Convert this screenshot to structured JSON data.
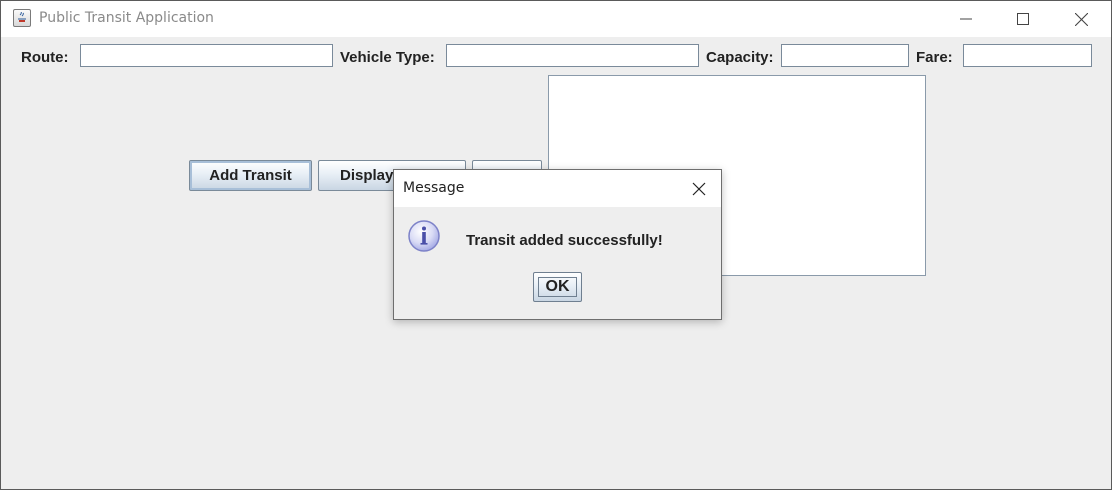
{
  "window": {
    "title": "Public Transit Application"
  },
  "form": {
    "route_label": "Route:",
    "route_value": "",
    "vehicle_type_label": "Vehicle Type:",
    "vehicle_type_value": "",
    "capacity_label": "Capacity:",
    "capacity_value": "",
    "fare_label": "Fare:",
    "fare_value": ""
  },
  "buttons": {
    "add_label": "Add Transit",
    "display_label": "Display",
    "third_label": ""
  },
  "output": {
    "text": ""
  },
  "dialog": {
    "title": "Message",
    "message": "Transit added successfully!",
    "ok_label": "OK",
    "icon": "info-icon"
  }
}
